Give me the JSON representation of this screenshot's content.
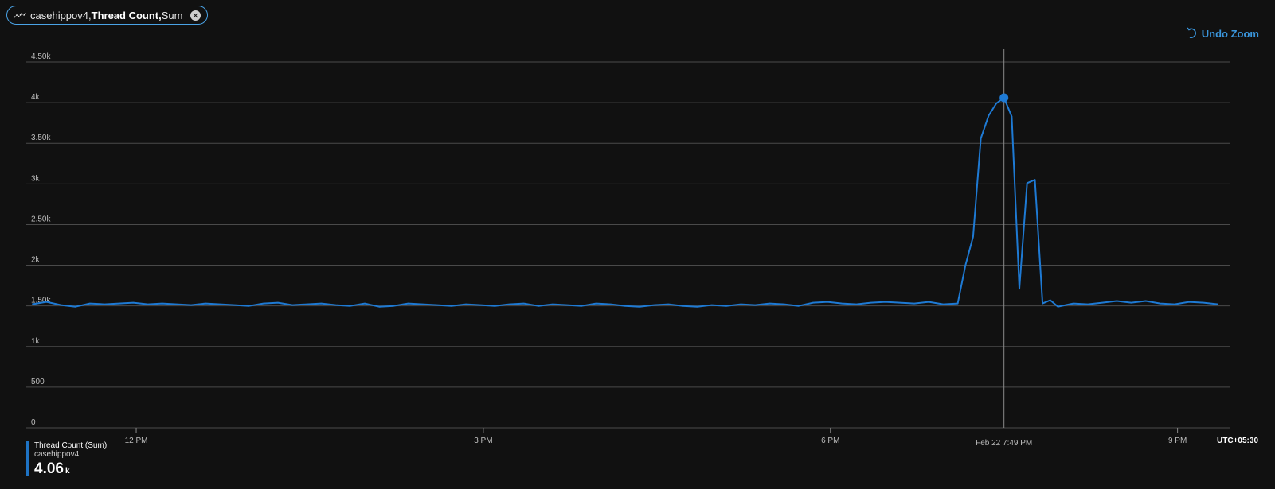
{
  "chip": {
    "resource": "casehippov4,",
    "metric": " Thread Count,",
    "aggregation": " Sum"
  },
  "undo_zoom": "Undo Zoom",
  "timezone": "UTC+05:30",
  "colors": {
    "series": "#1e7ad4",
    "grid": "#4a4a4a",
    "cursor": "#8a8a8a"
  },
  "chart_data": {
    "type": "line",
    "x_tick_labels": [
      "12 PM",
      "3 PM",
      "6 PM",
      "9 PM"
    ],
    "x_tick_values_hours": [
      12,
      15,
      18,
      21
    ],
    "cursor_label": "Feb 22 7:49 PM",
    "y_tick_labels": [
      "0",
      "500",
      "1k",
      "1.50k",
      "2k",
      "2.50k",
      "3k",
      "3.50k",
      "4k",
      "4.50k"
    ],
    "ylim": [
      0,
      4700
    ],
    "xlim_hours": [
      11.05,
      21.45
    ],
    "grid": true,
    "series": [
      {
        "name": "Thread Count (Sum)",
        "points_hours": [
          11.1,
          11.225,
          11.35,
          11.475,
          11.6,
          11.725,
          11.85,
          11.975,
          12.1,
          12.225,
          12.35,
          12.475,
          12.6,
          12.725,
          12.85,
          12.975,
          13.1,
          13.225,
          13.35,
          13.475,
          13.6,
          13.725,
          13.85,
          13.975,
          14.1,
          14.225,
          14.35,
          14.475,
          14.6,
          14.725,
          14.85,
          14.975,
          15.1,
          15.225,
          15.35,
          15.475,
          15.6,
          15.725,
          15.85,
          15.975,
          16.1,
          16.225,
          16.35,
          16.475,
          16.6,
          16.725,
          16.85,
          16.975,
          17.1,
          17.225,
          17.35,
          17.475,
          17.6,
          17.725,
          17.85,
          17.975,
          18.1,
          18.225,
          18.35,
          18.475,
          18.6,
          18.725,
          18.85,
          18.975,
          19.1,
          19.167,
          19.233,
          19.3,
          19.367,
          19.433,
          19.5,
          19.567,
          19.633,
          19.7,
          19.767,
          19.833,
          19.9,
          19.967,
          20.033,
          20.1,
          20.225,
          20.35,
          20.475,
          20.6,
          20.725,
          20.85,
          20.975,
          21.1,
          21.225,
          21.35
        ],
        "values": [
          1520,
          1550,
          1510,
          1490,
          1530,
          1520,
          1530,
          1540,
          1520,
          1530,
          1520,
          1510,
          1530,
          1520,
          1510,
          1500,
          1530,
          1540,
          1510,
          1520,
          1530,
          1510,
          1500,
          1530,
          1490,
          1500,
          1530,
          1520,
          1510,
          1500,
          1520,
          1510,
          1500,
          1520,
          1530,
          1500,
          1520,
          1510,
          1500,
          1530,
          1520,
          1500,
          1490,
          1510,
          1520,
          1500,
          1490,
          1510,
          1500,
          1520,
          1510,
          1530,
          1520,
          1500,
          1540,
          1550,
          1530,
          1520,
          1540,
          1550,
          1540,
          1530,
          1550,
          1520,
          1530,
          2000,
          2350,
          3560,
          3840,
          3990,
          4060,
          3830,
          1710,
          3010,
          3050,
          1530,
          1570,
          1490,
          1510,
          1530,
          1520,
          1540,
          1560,
          1540,
          1560,
          1530,
          1520,
          1550,
          1540,
          1520
        ],
        "peak_value": "4.06",
        "peak_unit": "k",
        "resource": "casehippov4"
      }
    ]
  }
}
